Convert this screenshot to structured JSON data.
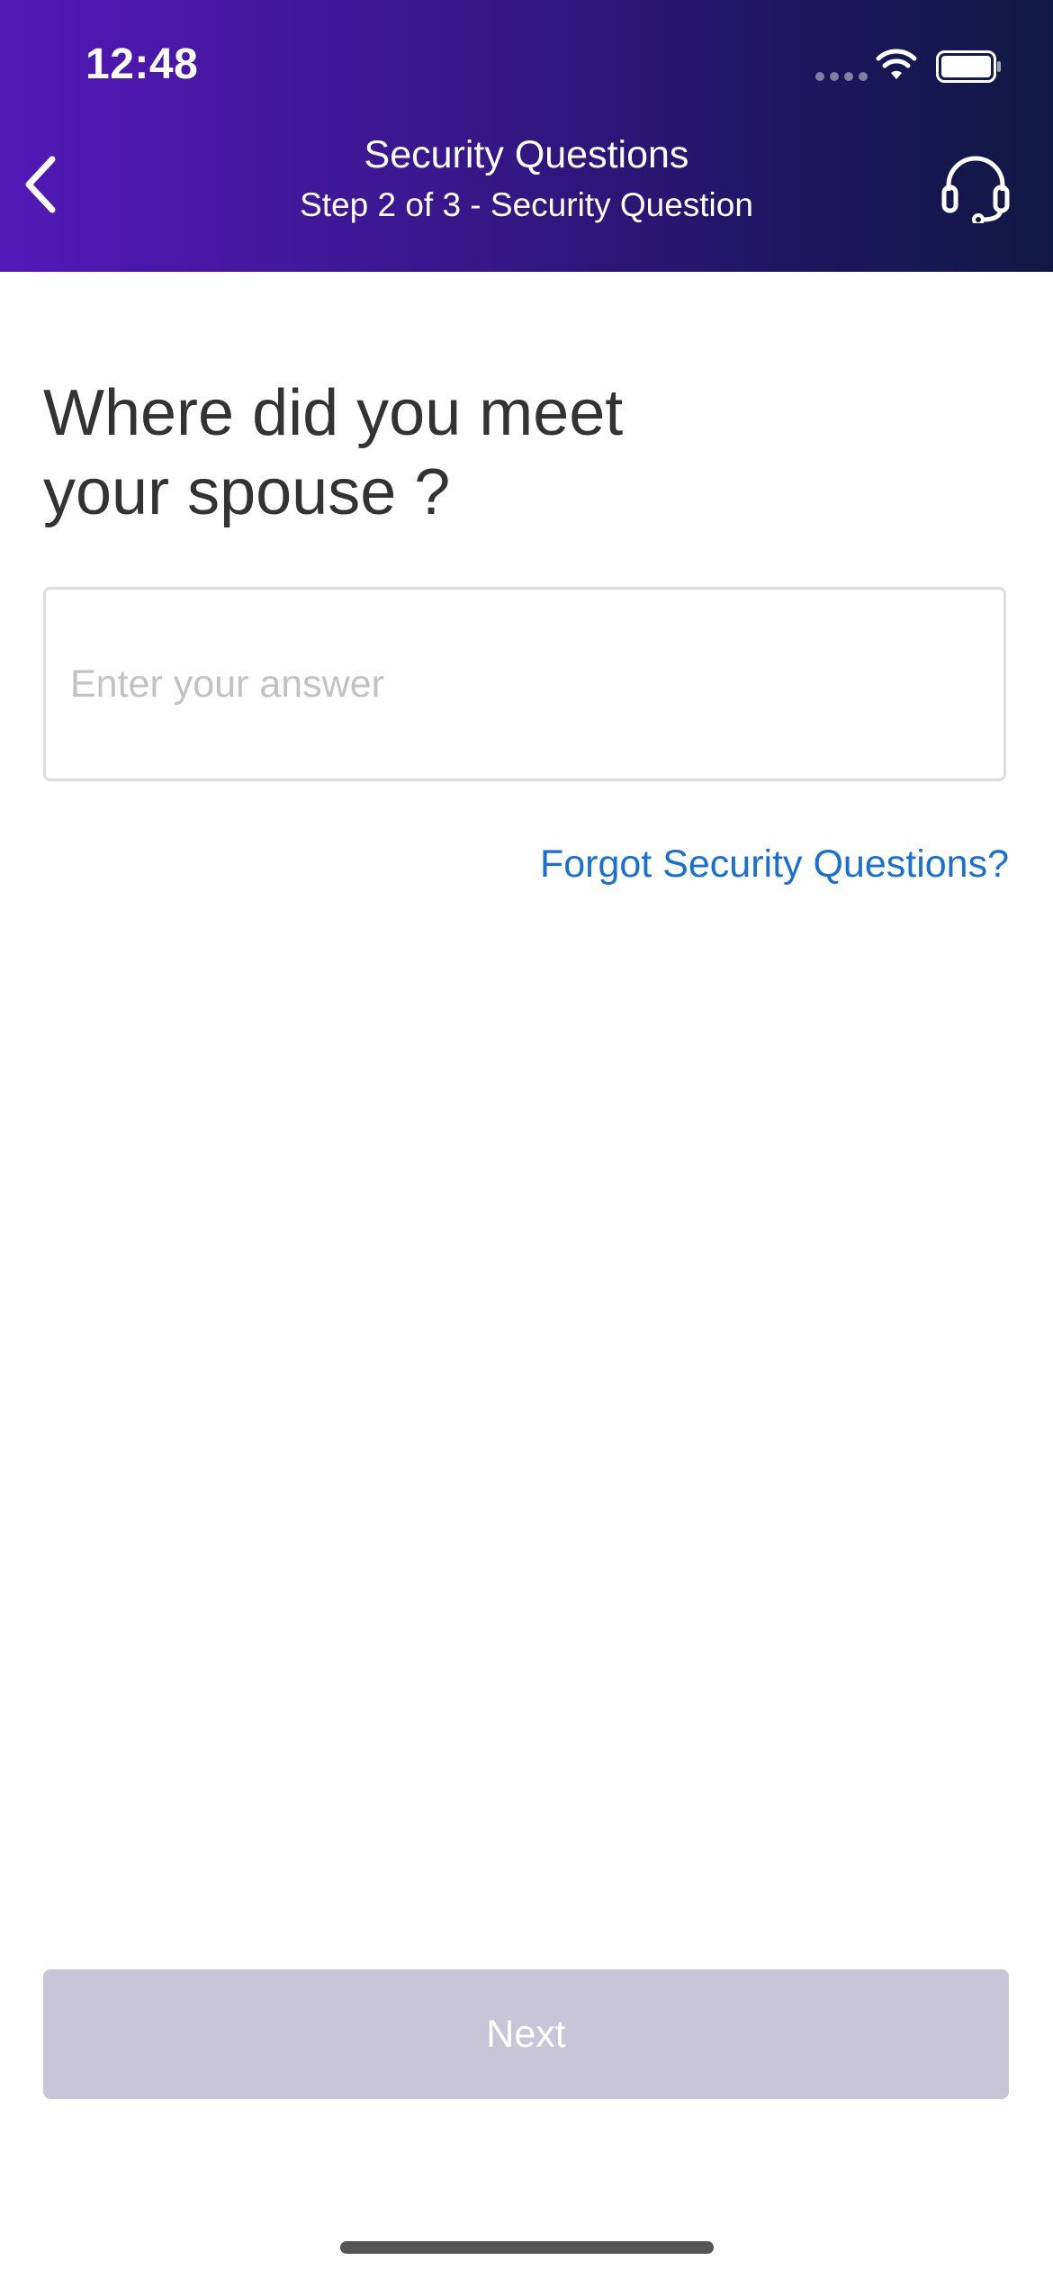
{
  "status_bar": {
    "time": "12:48"
  },
  "header": {
    "title": "Security Questions",
    "subtitle": "Step 2 of 3 - Security Question",
    "back_icon": "chevron-left-icon",
    "support_icon": "headset-icon"
  },
  "main": {
    "question": "Where did you meet your spouse ?",
    "answer_input": {
      "placeholder": "Enter your answer",
      "value": ""
    },
    "forgot_link": "Forgot Security Questions?"
  },
  "footer": {
    "next_label": "Next",
    "next_enabled": false
  },
  "colors": {
    "header_gradient_start": "#5219b8",
    "header_gradient_end": "#0f1842",
    "link": "#1a6fd4",
    "button_disabled": "#c8c5d8"
  }
}
